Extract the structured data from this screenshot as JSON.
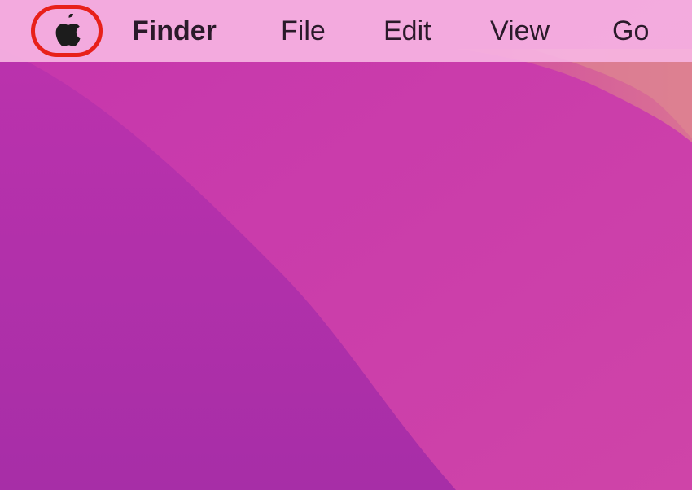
{
  "menubar": {
    "apple_menu_icon": "apple-logo-icon",
    "app_name": "Finder",
    "items": [
      {
        "label": "File"
      },
      {
        "label": "Edit"
      },
      {
        "label": "View"
      },
      {
        "label": "Go"
      }
    ]
  },
  "colors": {
    "menubar_bg": "#f6b4e2",
    "highlight_ring": "#e8201a",
    "wallpaper_dark": "#b62fa8",
    "wallpaper_mid": "#cc3ea6",
    "wallpaper_light": "#d97a94"
  }
}
